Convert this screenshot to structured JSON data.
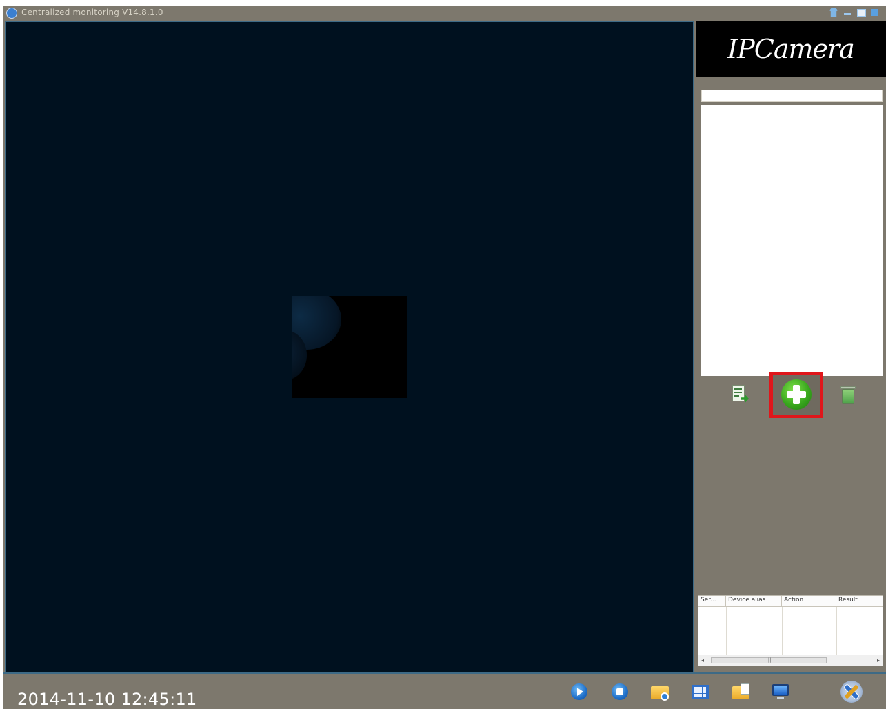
{
  "window": {
    "title": "Centralized monitoring  V14.8.1.0"
  },
  "titlebar": {
    "buttons": [
      "skin-icon",
      "minimize-icon",
      "maximize-icon",
      "close-icon"
    ]
  },
  "panel": {
    "logo_text": "IPCamera",
    "search_value": "",
    "actions": [
      "edit-device-icon",
      "add-device-icon",
      "delete-device-icon"
    ],
    "highlight_color": "#e0161b"
  },
  "log": {
    "columns": [
      "Ser...",
      "Device alias",
      "Action",
      "Result"
    ],
    "scroll_thumb": "|||"
  },
  "statusbar": {
    "datetime": "2014-11-10 12:45:11",
    "icons": [
      "play-icon",
      "stop-icon",
      "record-folder-icon",
      "layout-grid-icon",
      "snapshot-folder-icon",
      "monitor-icon",
      "settings-tools-icon"
    ]
  },
  "colors": {
    "frame": "#7d786d",
    "video_bg": "#00111f",
    "logo_bg": "#000000"
  }
}
